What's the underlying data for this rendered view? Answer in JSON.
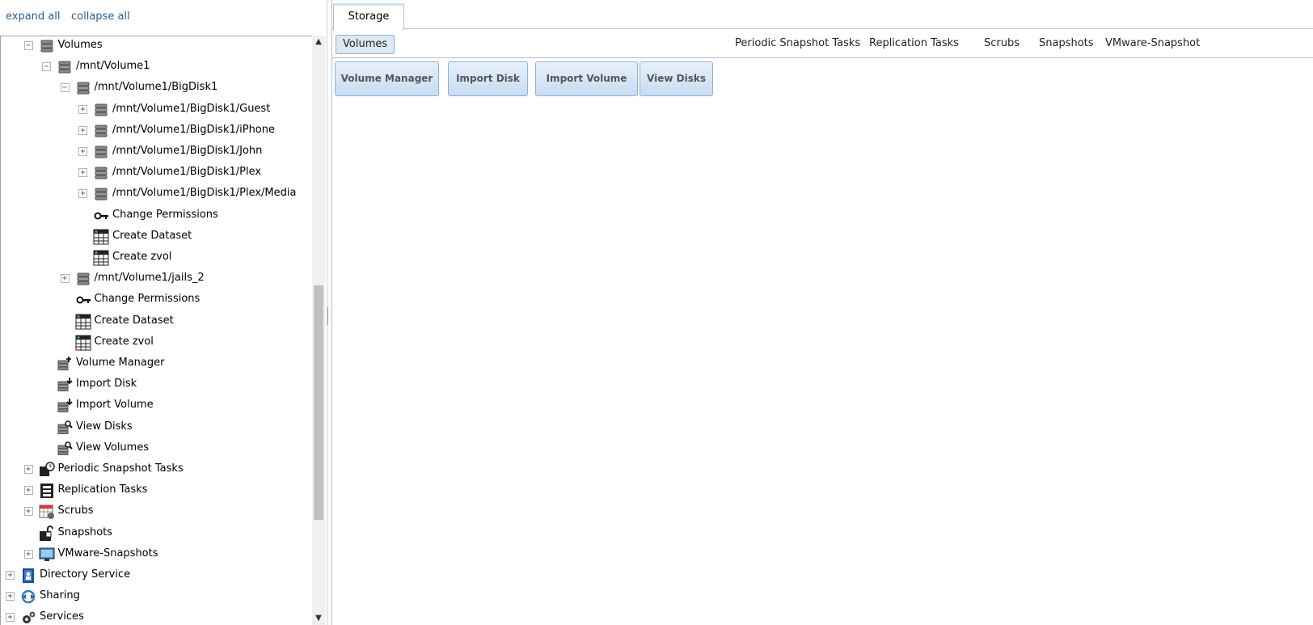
{
  "topbar": {
    "expand_all": "expand all",
    "collapse_all": "collapse all"
  },
  "tree": [
    {
      "label": "Volumes",
      "expander": "−",
      "icon": "database-icon",
      "depth": 1
    },
    {
      "label": "/mnt/Volume1",
      "expander": "−",
      "icon": "database-icon",
      "depth": 2
    },
    {
      "label": "/mnt/Volume1/BigDisk1",
      "expander": "−",
      "icon": "database-icon",
      "depth": 3
    },
    {
      "label": "/mnt/Volume1/BigDisk1/Guest",
      "expander": "+",
      "icon": "database-icon",
      "depth": 4
    },
    {
      "label": "/mnt/Volume1/BigDisk1/iPhone",
      "expander": "+",
      "icon": "database-icon",
      "depth": 4
    },
    {
      "label": "/mnt/Volume1/BigDisk1/John",
      "expander": "+",
      "icon": "database-icon",
      "depth": 4
    },
    {
      "label": "/mnt/Volume1/BigDisk1/Plex",
      "expander": "+",
      "icon": "database-icon",
      "depth": 4
    },
    {
      "label": "/mnt/Volume1/BigDisk1/Plex/Media",
      "expander": "+",
      "icon": "database-icon",
      "depth": 4
    },
    {
      "label": "Change Permissions",
      "expander": "",
      "icon": "key-icon",
      "depth": 4
    },
    {
      "label": "Create Dataset",
      "expander": "",
      "icon": "table-icon",
      "depth": 4
    },
    {
      "label": "Create zvol",
      "expander": "",
      "icon": "table-icon",
      "depth": 4
    },
    {
      "label": "/mnt/Volume1/jails_2",
      "expander": "+",
      "icon": "database-icon",
      "depth": 3
    },
    {
      "label": "Change Permissions",
      "expander": "",
      "icon": "key-icon",
      "depth": 3
    },
    {
      "label": "Create Dataset",
      "expander": "",
      "icon": "table-icon",
      "depth": 3
    },
    {
      "label": "Create zvol",
      "expander": "",
      "icon": "table-icon",
      "depth": 3
    },
    {
      "label": "Volume Manager",
      "expander": "",
      "icon": "volume-manager-icon",
      "depth": 2
    },
    {
      "label": "Import Disk",
      "expander": "",
      "icon": "import-icon",
      "depth": 2
    },
    {
      "label": "Import Volume",
      "expander": "",
      "icon": "import-icon",
      "depth": 2
    },
    {
      "label": "View Disks",
      "expander": "",
      "icon": "view-icon",
      "depth": 2
    },
    {
      "label": "View Volumes",
      "expander": "",
      "icon": "view-icon",
      "depth": 2
    },
    {
      "label": "Periodic Snapshot Tasks",
      "expander": "+",
      "icon": "clock-icon",
      "depth": 1
    },
    {
      "label": "Replication Tasks",
      "expander": "+",
      "icon": "film-icon",
      "depth": 1
    },
    {
      "label": "Scrubs",
      "expander": "+",
      "icon": "calendar-icon",
      "depth": 1
    },
    {
      "label": "Snapshots",
      "expander": "",
      "icon": "snapshot-icon",
      "depth": 1
    },
    {
      "label": "VMware-Snapshots",
      "expander": "+",
      "icon": "monitor-icon",
      "depth": 1
    },
    {
      "label": "Directory Service",
      "expander": "+",
      "icon": "directory-icon",
      "depth": 0
    },
    {
      "label": "Sharing",
      "expander": "+",
      "icon": "sharing-icon",
      "depth": 0
    },
    {
      "label": "Services",
      "expander": "+",
      "icon": "services-icon",
      "depth": 0
    }
  ],
  "main": {
    "tab": "Storage",
    "subtabs": [
      "Volumes",
      "Periodic Snapshot Tasks",
      "Replication Tasks",
      "Scrubs",
      "Snapshots",
      "VMware-Snapshot"
    ],
    "buttons": [
      "Volume Manager",
      "Import Disk",
      "Import Volume",
      "View Disks"
    ]
  },
  "scroll": {
    "up_arrow": "▲",
    "down_arrow": "▼"
  }
}
